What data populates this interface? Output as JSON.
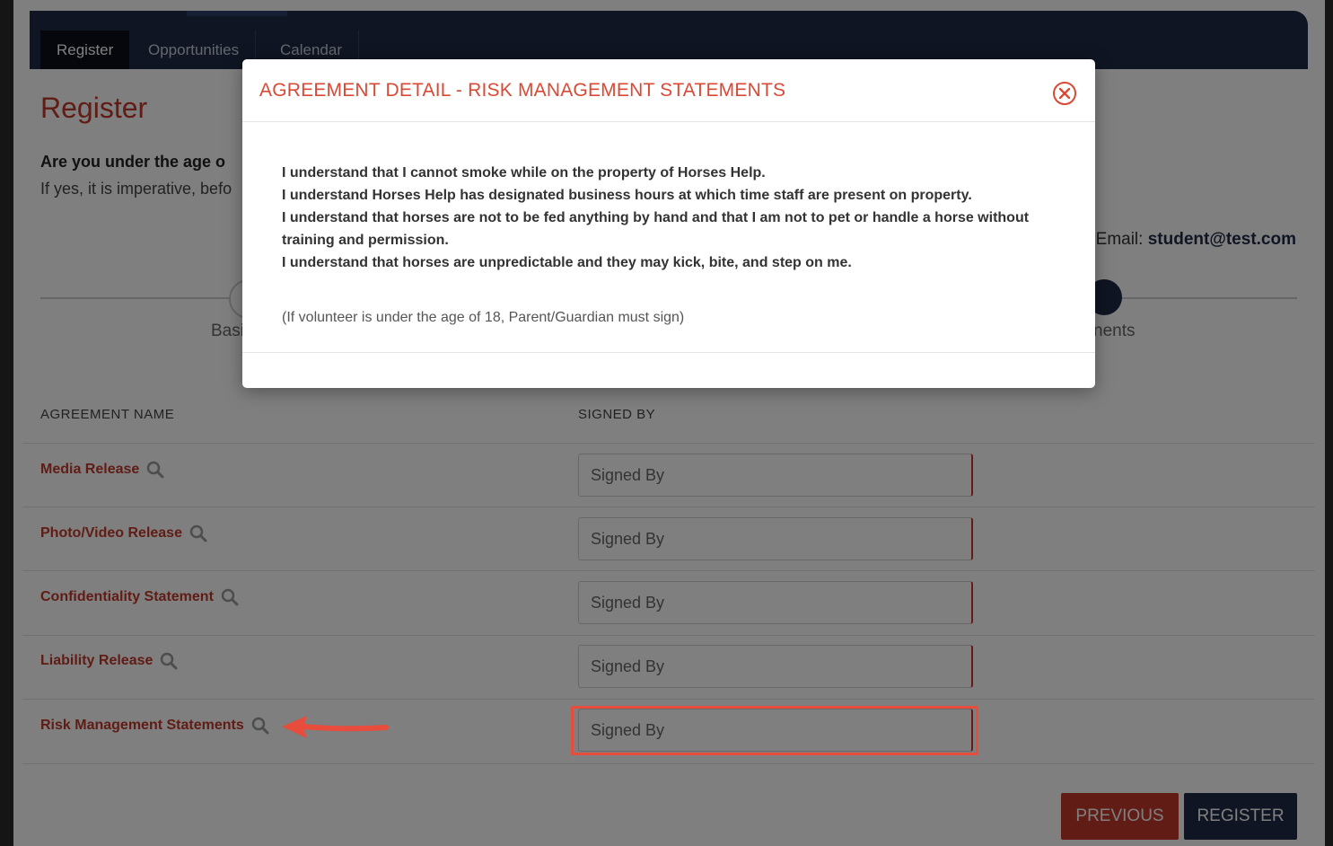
{
  "nav": {
    "tabs": [
      {
        "label": "Register",
        "active": true
      },
      {
        "label": "Opportunities",
        "active": false
      },
      {
        "label": "Calendar",
        "active": false
      }
    ]
  },
  "page": {
    "title": "Register",
    "age_question_visible": "Are you under the age o",
    "age_note_visible": "If yes, it is imperative, befo",
    "email_label": "Email:",
    "email_value": "student@test.com"
  },
  "steps": {
    "basic_label_visible": "Basi",
    "agreements_label_visible": "nents"
  },
  "table": {
    "col_name": "AGREEMENT NAME",
    "col_signed": "SIGNED BY",
    "rows": [
      {
        "name": "Media Release",
        "signed_placeholder": "Signed By"
      },
      {
        "name": "Photo/Video Release",
        "signed_placeholder": "Signed By"
      },
      {
        "name": "Confidentiality Statement",
        "signed_placeholder": "Signed By"
      },
      {
        "name": "Liability Release",
        "signed_placeholder": "Signed By"
      },
      {
        "name": "Risk Management Statements",
        "signed_placeholder": "Signed By"
      }
    ]
  },
  "buttons": {
    "previous": "PREVIOUS",
    "register": "REGISTER"
  },
  "modal": {
    "title": "AGREEMENT DETAIL - RISK MANAGEMENT STATEMENTS",
    "statements": [
      "I understand that I cannot smoke while on the property of Horses Help.",
      "I understand Horses Help has designated business hours at which time staff are present on property.",
      "I understand that horses are not to be fed anything by hand and that I am not to pet or handle a horse without training and permission.",
      "I understand that horses are unpredictable and they may kick, bite, and step on me."
    ],
    "note": "(If volunteer is under the age of 18, Parent/Guardian must sign)"
  },
  "colors": {
    "accent_red": "#c0392b",
    "navy": "#1f2a44",
    "highlight": "#e74c3c"
  },
  "icons": {
    "close": "close-circle-icon",
    "view": "magnifier-icon",
    "annotation": "arrow-left-icon"
  }
}
